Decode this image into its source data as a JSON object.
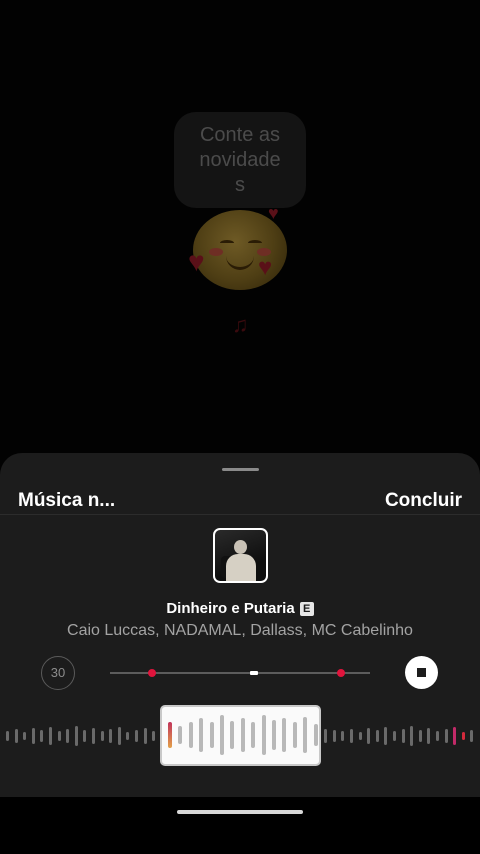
{
  "preview": {
    "note_text": "Conte as novidade s",
    "note_lines": [
      "Conte as",
      "novidade",
      "s"
    ]
  },
  "sheet": {
    "title": "Música n...",
    "done_label": "Concluir"
  },
  "track": {
    "song_title": "Dinheiro e Putaria",
    "explicit_badge": "E",
    "artists": "Caio Luccas, NADAMAL, Dallass, MC Cabelinho",
    "duration_label": "30"
  },
  "colors": {
    "sheet_bg": "#1c1c1c",
    "accent_red": "#e0143c",
    "text_secondary": "#a3a3a3"
  },
  "icons": {
    "stop": "stop-icon",
    "album_cover": "album-cover"
  }
}
